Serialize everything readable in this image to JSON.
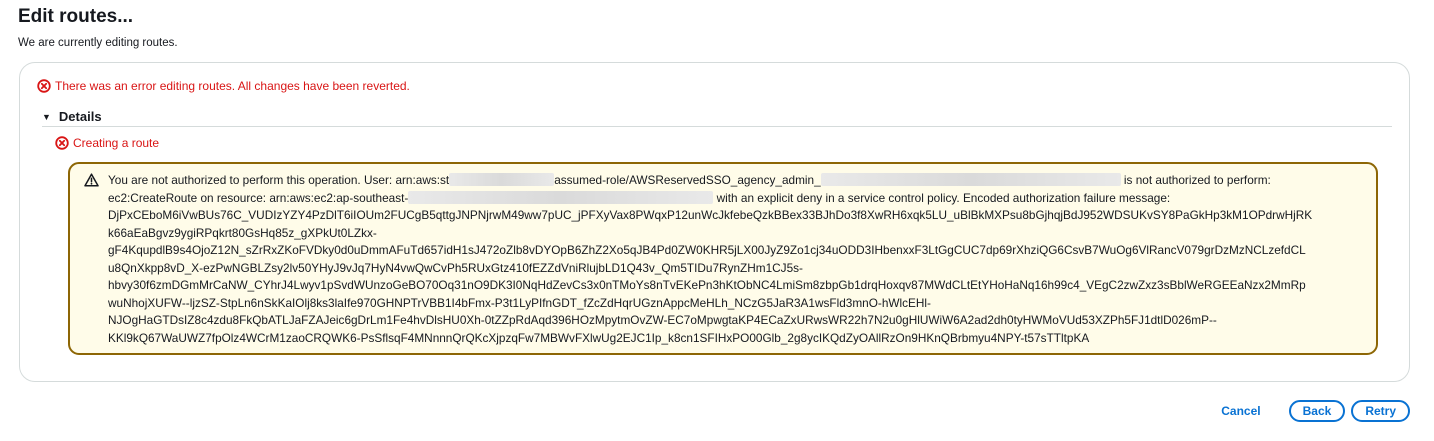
{
  "header": {
    "title": "Edit routes...",
    "subtitle": "We are currently editing routes."
  },
  "status": {
    "error_message": "There was an error editing routes. All changes have been reverted.",
    "details_label": "Details",
    "sub_error": "Creating a route",
    "warning_lines": [
      [
        "You are not authorized to perform this operation. User: arn:aws:st",
        "assumed-role/AWSReservedSSO_agency_admin_",
        "is not authorized to perform:"
      ],
      [
        "ec2:CreateRoute on resource: arn:aws:ec2:ap-southeast-",
        "with an explicit deny in a service control policy. Encoded authorization failure message:"
      ],
      "DjPxCEboM6iVwBUs76C_VUDIzYZY4PzDlT6iIOUm2FUCgB5qttgJNPNjrwM49ww7pUC_jPFXyVax8PWqxP12unWcJkfebeQzkBBex33BJhDo3f8XwRH6xqk5LU_uBlBkMXPsu8bGjhqjBdJ952WDSUKvSY8PaGkHp3kM1OPdrwHjRK",
      "k66aEaBgvz9ygiRPqkrt80GsHq85z_gXPkUt0LZkx-",
      "gF4KqupdlB9s4OjoZ12N_sZrRxZKoFVDky0d0uDmmAFuTd657idH1sJ472oZlb8vDYOpB6ZhZ2Xo5qJB4Pd0ZW0KHR5jLX00JyZ9Zo1cj34uODD3IHbenxxF3LtGgCUC7dp69rXhziQG6CsvB7WuOg6VlRancV079grDzMzNCLzefdCL",
      "u8QnXkpp8vD_X-ezPwNGBLZsy2lv50YHyJ9vJq7HyN4vwQwCvPh5RUxGtz410fEZZdVniRlujbLD1Q43v_Qm5TIDu7RynZHm1CJ5s-",
      "hbvy30f6zmDGmMrCaNW_CYhrJ4Lwyv1pSvdWUnzoGeBO70Oq31nO9DK3I0NqHdZevCs3x0nTMoYs8nTvEKePn3hKtObNC4LmiSm8zbpGb1drqHoxqv87MWdCLtEtYHoHaNq16h99c4_VEgC2zwZxz3sBblWeRGEEaNzx2MmRp",
      "wuNhojXUFW--ljzSZ-StpLn6nSkKaIOlj8ks3laIfe970GHNPTrVBB1I4bFmx-P3t1LyPIfnGDT_fZcZdHqrUGznAppcMeHLh_NCzG5JaR3A1wsFld3mnO-hWlcEHl-",
      "NJOgHaGTDsIZ8c4zdu8FkQbATLJaFZAJeic6gDrLm1Fe4hvDlsHU0Xh-0tZZpRdAqd396HOzMpytmOvZW-EC7oMpwgtaKP4ECaZxURwsWR22h7N2u0gHlUWiW6A2ad2dh0tyHWMoVUd53XZPh5FJ1dtlD026mP--",
      "KKl9kQ67WaUWZ7fpOlz4WCrM1zaoCRQWK6-PsSflsqF4MNnnnQrQKcXjpzqFw7MBWvFXlwUg2EJC1Ip_k8cn1SFIHxPO00Glb_2g8ycIKQdZyOAllRzOn9HKnQBrbmyu4NPY-t57sTTltpKA"
    ]
  },
  "actions": {
    "cancel": "Cancel",
    "back": "Back",
    "retry": "Retry"
  },
  "colors": {
    "error": "#d91515",
    "warning_border": "#8d6605",
    "warning_bg": "#fffce9",
    "primary": "#0972d3"
  },
  "icons": {
    "error": "x-circle-icon",
    "warning": "warning-triangle-icon",
    "caret": "caret-down-icon"
  }
}
